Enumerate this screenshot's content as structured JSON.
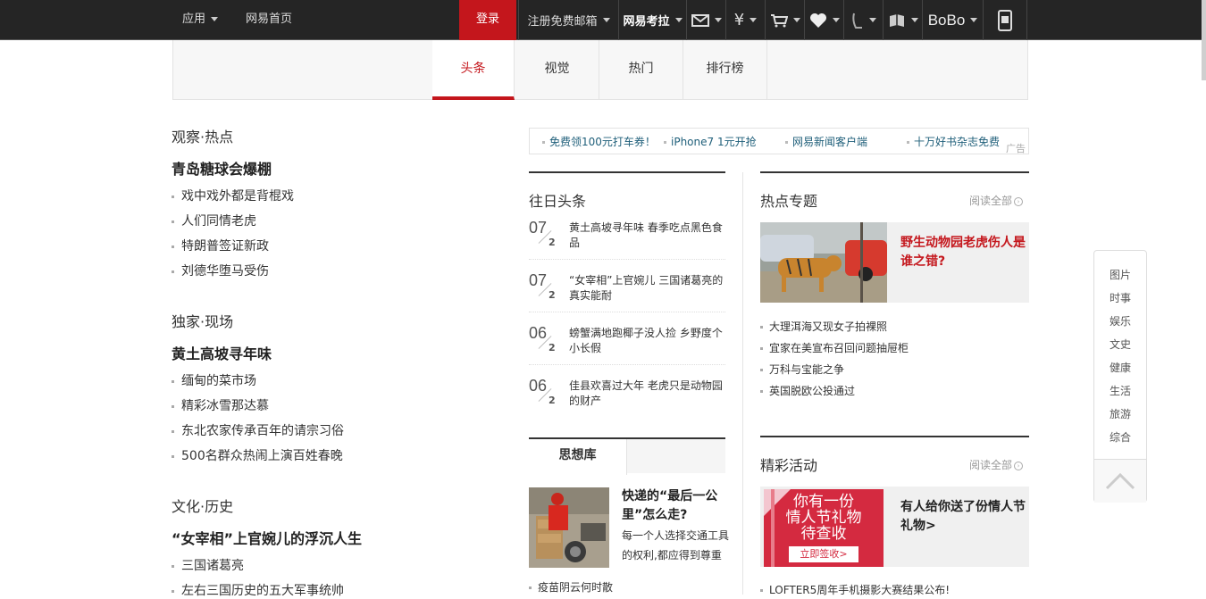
{
  "topbar": {
    "apps_label": "应用",
    "home_label": "网易首页",
    "login_label": "登录",
    "register_label": "注册免费邮箱",
    "kaola_label": "网易考拉",
    "bobo_label": "BoBo"
  },
  "nav": {
    "tabs": [
      {
        "label": "头条"
      },
      {
        "label": "视觉"
      },
      {
        "label": "热门"
      },
      {
        "label": "排行榜"
      }
    ]
  },
  "left": {
    "sections": [
      {
        "title": "观察·热点",
        "headline": "青岛糖球会爆棚",
        "items": [
          "戏中戏外都是背棍戏",
          "人们同情老虎",
          "特朗普签证新政",
          "刘德华堕马受伤"
        ]
      },
      {
        "title": "独家·现场",
        "headline": "黄土高坡寻年味",
        "items": [
          "缅甸的菜市场",
          "精彩冰雪那达慕",
          "东北农家传承百年的请宗习俗",
          "500名群众热闹上演百姓春晚"
        ]
      },
      {
        "title": "文化·历史",
        "headline": "“女宰相”上官婉儿的浮沉人生",
        "items": [
          "三国诸葛亮",
          "左右三国历史的五大军事统帅"
        ]
      }
    ]
  },
  "adbar": {
    "items": [
      "免费领100元打车券！",
      "iPhone7 1元开抢",
      "网易新闻客户端",
      "十万好书杂志免费"
    ],
    "label": "广告"
  },
  "past": {
    "title": "往日头条",
    "items": [
      {
        "d1": "07",
        "d2": "2",
        "text": "黄土高坡寻年味 春季吃点黑色食品"
      },
      {
        "d1": "07",
        "d2": "2",
        "text": "“女宰相”上官婉儿 三国诸葛亮的真实能耐"
      },
      {
        "d1": "06",
        "d2": "2",
        "text": "螃蟹满地跑椰子没人捡 乡野度个小长假"
      },
      {
        "d1": "06",
        "d2": "2",
        "text": "佳县欢喜过大年 老虎只是动物园的财产"
      }
    ]
  },
  "think": {
    "tab": "思想库",
    "caption": "快递的“最后一公里”怎么走?",
    "desc": "每一个人选择交通工具的权利,都应得到尊重",
    "bottom": "疫苗阴云何时散"
  },
  "hot": {
    "title": "热点专题",
    "more": "阅读全部",
    "caption": "野生动物园老虎伤人是谁之错?",
    "items": [
      "大理洱海又现女子拍裸照",
      "宜家在美宣布召回问题抽屉柜",
      "万科与宝能之争",
      "英国脱欧公投通过"
    ]
  },
  "activity": {
    "title": "精彩活动",
    "more": "阅读全部",
    "img_line1": "你有一份",
    "img_line2": "情人节礼物",
    "img_line3": "待查收",
    "img_btn": "立即签收>",
    "caption": "有人给你送了份情人节礼物>",
    "bottom": "LOFTER5周年手机摄影大赛结果公布!"
  },
  "sidenav": {
    "items": [
      "图片",
      "时事",
      "娱乐",
      "文史",
      "健康",
      "生活",
      "旅游",
      "综合"
    ]
  }
}
